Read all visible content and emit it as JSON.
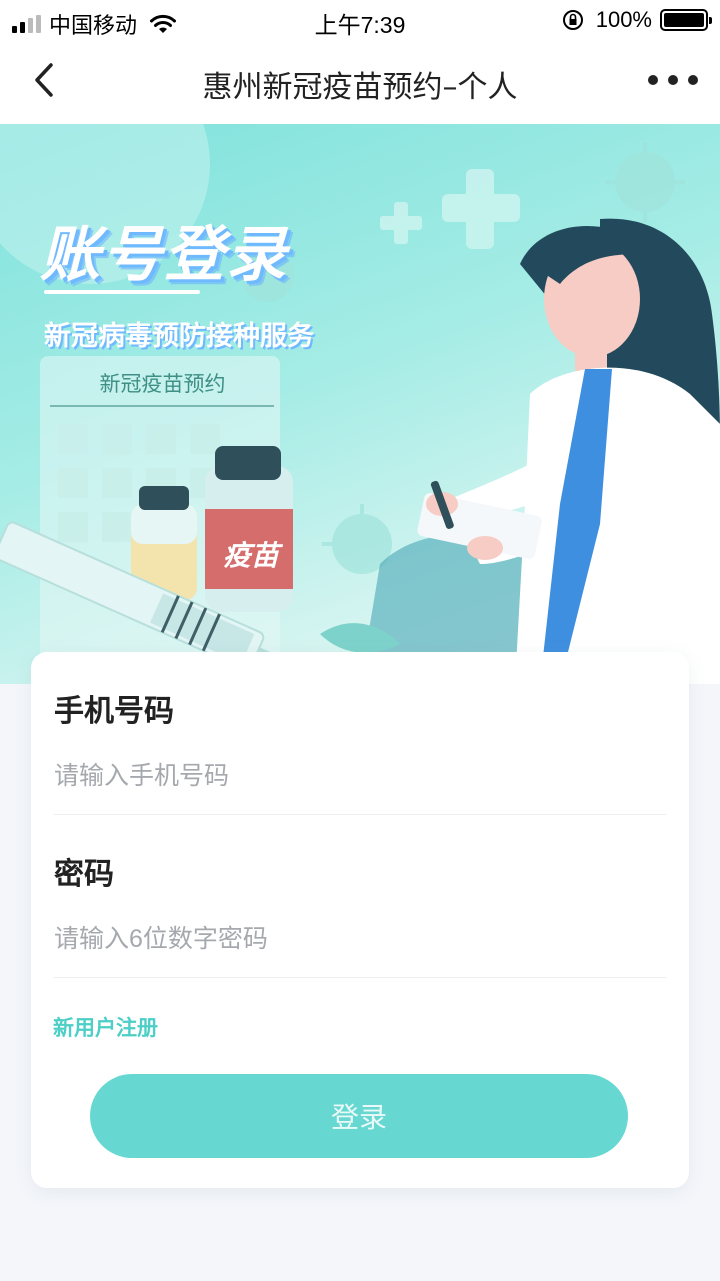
{
  "status_bar": {
    "carrier": "中国移动",
    "time": "上午7:39",
    "battery": "100%",
    "battery_level": 1.0
  },
  "nav": {
    "title": "惠州新冠疫苗预约–个人"
  },
  "banner": {
    "title": "账号登录",
    "subtitle": "新冠病毒预防接种服务",
    "board_caption": "新冠疫苗预约",
    "vaccine_label": "疫苗"
  },
  "form": {
    "phone_label": "手机号码",
    "phone_placeholder": "请输入手机号码",
    "password_label": "密码",
    "password_placeholder": "请输入6位数字密码",
    "register_link": "新用户注册",
    "login_button": "登录"
  },
  "colors": {
    "accent": "#66d8d1",
    "link": "#4ccfc6",
    "banner_bg": "#a6ece6"
  }
}
